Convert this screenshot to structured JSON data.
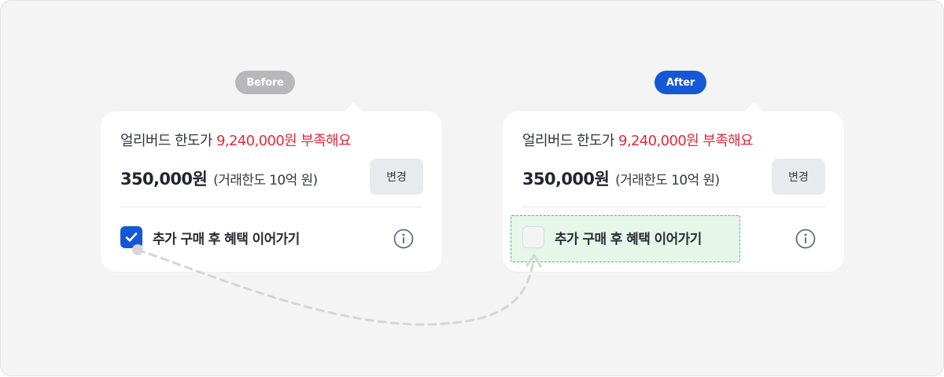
{
  "labels": {
    "before": "Before",
    "after": "After"
  },
  "before_card": {
    "limit_prefix": "얼리버드 한도가 ",
    "limit_warning": "9,240,000원 부족해요",
    "amount": "350,000원",
    "amount_note": "(거래한도 10억 원)",
    "change_label": "변경",
    "option_label": "추가 구매 후 혜택 이어가기",
    "option_checked": true
  },
  "after_card": {
    "limit_prefix": "얼리버드 한도가 ",
    "limit_warning": "9,240,000원 부족해요",
    "amount": "350,000원",
    "amount_note": "(거래한도 10억 원)",
    "change_label": "변경",
    "option_label": "추가 구매 후 혜택 이어가기",
    "option_checked": false
  },
  "colors": {
    "accent": "#1558d6",
    "warning": "#e42a3b",
    "highlight": "#e4f7e9",
    "highlight_border": "#49c06c",
    "before_pill": "#b8b8bb"
  },
  "icons": {
    "check": "checkmark-icon",
    "info": "info-icon"
  }
}
